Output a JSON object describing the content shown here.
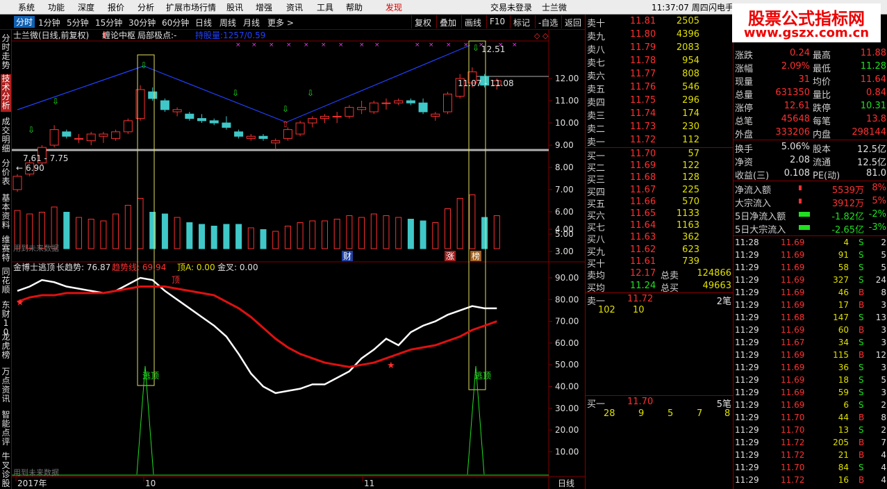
{
  "menu": [
    "系统",
    "功能",
    "深度",
    "报价",
    "分析",
    "扩展市场行情",
    "股讯",
    "增强",
    "资讯",
    "工具",
    "帮助",
    "发现"
  ],
  "menu_status": {
    "login": "交易未登录",
    "stock": "士兰微",
    "time": "11:37:07 周四",
    "flash": "闪电手"
  },
  "periods": [
    "分时",
    "1分钟",
    "5分钟",
    "15分钟",
    "30分钟",
    "60分钟",
    "日线",
    "周线",
    "月线",
    "更多 >"
  ],
  "toolbar_buttons": [
    "复权",
    "叠加",
    "画线",
    "F10",
    "标记",
    "-自选",
    "返回"
  ],
  "side_tabs": [
    "分时走势",
    "技术分析",
    "成交明细",
    "分价表",
    "基本资料",
    "维赛特",
    "同花顺",
    "东财10",
    "龙虎榜",
    "万点资讯",
    "智能点评",
    "牛叉诊股"
  ],
  "logo": {
    "line1": "股票公式指标网",
    "line2": "www.gszx.com.cn"
  },
  "main_chart": {
    "header": "士兰微(日线,前复权)",
    "indicator1": "缠论中枢",
    "indicator2": "局部极点:-",
    "indicator3": "持股量:1257/0.59",
    "price_ticks": [
      "12.00",
      "11.00",
      "10.00",
      "9.00",
      "8.00",
      "7.00",
      "6.00",
      "5.00",
      "4.00",
      "3.00"
    ],
    "label_high": "12.51",
    "label_range_top": "11.07 - 11.08",
    "label_range_bot": "7.61 - 7.75",
    "label_low": "6.90",
    "volume_note": "用到未来数据",
    "badges": [
      "财",
      "涨",
      "榜"
    ]
  },
  "chart_data": {
    "type": "candlestick",
    "title": "士兰微(日线,前复权)",
    "candles": [
      {
        "o": 7.0,
        "h": 7.7,
        "l": 6.9,
        "c": 7.6
      },
      {
        "o": 7.7,
        "h": 8.3,
        "l": 7.6,
        "c": 8.2
      },
      {
        "o": 8.2,
        "h": 9.0,
        "l": 8.1,
        "c": 8.9
      },
      {
        "o": 9.0,
        "h": 9.9,
        "l": 8.9,
        "c": 9.7
      },
      {
        "o": 9.6,
        "h": 9.7,
        "l": 9.3,
        "c": 9.4
      },
      {
        "o": 9.3,
        "h": 9.5,
        "l": 9.1,
        "c": 9.3
      },
      {
        "o": 9.2,
        "h": 9.6,
        "l": 9.0,
        "c": 9.5
      },
      {
        "o": 9.4,
        "h": 9.6,
        "l": 9.1,
        "c": 9.5
      },
      {
        "o": 9.3,
        "h": 9.7,
        "l": 9.2,
        "c": 9.6
      },
      {
        "o": 9.6,
        "h": 10.2,
        "l": 9.5,
        "c": 10.1
      },
      {
        "o": 10.2,
        "h": 11.7,
        "l": 10.1,
        "c": 11.5
      },
      {
        "o": 11.4,
        "h": 11.6,
        "l": 11.0,
        "c": 11.1
      },
      {
        "o": 11.0,
        "h": 11.1,
        "l": 10.5,
        "c": 10.6
      },
      {
        "o": 10.5,
        "h": 10.7,
        "l": 10.3,
        "c": 10.6
      },
      {
        "o": 10.4,
        "h": 10.5,
        "l": 10.1,
        "c": 10.2
      },
      {
        "o": 10.2,
        "h": 10.4,
        "l": 10.0,
        "c": 10.1
      },
      {
        "o": 10.1,
        "h": 10.2,
        "l": 9.9,
        "c": 10.0
      },
      {
        "o": 10.0,
        "h": 10.3,
        "l": 9.7,
        "c": 9.8
      },
      {
        "o": 9.6,
        "h": 9.7,
        "l": 9.3,
        "c": 9.4
      },
      {
        "o": 9.3,
        "h": 9.5,
        "l": 9.2,
        "c": 9.4
      },
      {
        "o": 9.4,
        "h": 9.5,
        "l": 9.2,
        "c": 9.3
      },
      {
        "o": 9.1,
        "h": 9.3,
        "l": 8.8,
        "c": 9.2
      },
      {
        "o": 9.3,
        "h": 9.8,
        "l": 9.2,
        "c": 9.7
      },
      {
        "o": 9.5,
        "h": 10.1,
        "l": 9.4,
        "c": 10.0
      },
      {
        "o": 10.0,
        "h": 10.3,
        "l": 9.8,
        "c": 10.2
      },
      {
        "o": 10.2,
        "h": 10.4,
        "l": 10.0,
        "c": 10.3
      },
      {
        "o": 10.3,
        "h": 10.5,
        "l": 10.0,
        "c": 10.3
      },
      {
        "o": 10.3,
        "h": 10.8,
        "l": 10.2,
        "c": 10.7
      },
      {
        "o": 10.6,
        "h": 11.0,
        "l": 10.4,
        "c": 10.7
      },
      {
        "o": 10.5,
        "h": 11.0,
        "l": 10.4,
        "c": 10.9
      },
      {
        "o": 10.9,
        "h": 11.1,
        "l": 10.6,
        "c": 10.9
      },
      {
        "o": 10.9,
        "h": 11.1,
        "l": 10.8,
        "c": 11.0
      },
      {
        "o": 11.0,
        "h": 11.1,
        "l": 10.8,
        "c": 10.9
      },
      {
        "o": 10.9,
        "h": 11.1,
        "l": 10.4,
        "c": 10.5
      },
      {
        "o": 10.3,
        "h": 10.5,
        "l": 10.1,
        "c": 10.4
      },
      {
        "o": 10.5,
        "h": 11.4,
        "l": 10.4,
        "c": 11.3
      },
      {
        "o": 11.2,
        "h": 12.2,
        "l": 11.1,
        "c": 12.0
      },
      {
        "o": 11.8,
        "h": 12.5,
        "l": 11.6,
        "c": 12.3
      },
      {
        "o": 12.1,
        "h": 12.2,
        "l": 11.6,
        "c": 11.7
      },
      {
        "o": 11.7,
        "h": 12.0,
        "l": 11.5,
        "c": 11.9
      }
    ],
    "volume": [
      2.2,
      2.0,
      2.1,
      2.4,
      2.1,
      1.8,
      1.7,
      1.6,
      2.0,
      2.5,
      2.9,
      2.1,
      2.0,
      1.8,
      1.5,
      1.4,
      1.3,
      1.4,
      1.4,
      1.2,
      1.1,
      1.0,
      1.3,
      1.5,
      1.6,
      1.6,
      1.7,
      1.9,
      1.8,
      2.0,
      1.9,
      1.8,
      1.7,
      1.6,
      1.5,
      2.3,
      2.9,
      3.1,
      1.8,
      1.9
    ],
    "osc_ticks": [
      "90.00",
      "80.00",
      "70.00",
      "60.00",
      "50.00",
      "40.00",
      "30.00",
      "20.00",
      "10.00"
    ],
    "white_line": [
      84,
      86,
      89,
      88,
      86,
      85,
      84,
      83,
      84,
      87,
      90,
      89,
      84,
      80,
      76,
      72,
      68,
      63,
      55,
      46,
      40,
      37,
      38,
      39,
      41,
      41,
      44,
      47,
      53,
      57,
      62,
      59,
      65,
      68,
      70,
      73,
      75,
      77,
      76,
      76
    ],
    "red_line": [
      79,
      81,
      82,
      82,
      83,
      83,
      83,
      83,
      84,
      85,
      86,
      86,
      86,
      85,
      84,
      83,
      82,
      79,
      76,
      72,
      67,
      62,
      58,
      55,
      53,
      51,
      50,
      49,
      50,
      51,
      53,
      55,
      57,
      58,
      59,
      61,
      63,
      66,
      68,
      70
    ],
    "x_labels": [
      "2017年",
      "10",
      "11"
    ]
  },
  "sub_chart": {
    "name": "金博士逃顶",
    "long_trend_label": "长趋势: 76.87",
    "trend_label": "趋势线: 69.94",
    "top_label": "顶A: 0.00",
    "gold_label": "金叉: 0.00",
    "top_mark": "顶",
    "escape1": "逃顶",
    "escape2": "逃顶",
    "future_note": "用到未来数据",
    "bottom_tab": "日线"
  },
  "quote": {
    "asks": [
      {
        "l": "卖十",
        "p": "11.81",
        "v": "2505"
      },
      {
        "l": "卖九",
        "p": "11.80",
        "v": "4396"
      },
      {
        "l": "卖八",
        "p": "11.79",
        "v": "2083"
      },
      {
        "l": "卖七",
        "p": "11.78",
        "v": "954"
      },
      {
        "l": "卖六",
        "p": "11.77",
        "v": "808"
      },
      {
        "l": "卖五",
        "p": "11.76",
        "v": "546"
      },
      {
        "l": "卖四",
        "p": "11.75",
        "v": "296"
      },
      {
        "l": "卖三",
        "p": "11.74",
        "v": "174"
      },
      {
        "l": "卖二",
        "p": "11.73",
        "v": "230"
      },
      {
        "l": "卖一",
        "p": "11.72",
        "v": "112"
      }
    ],
    "bids": [
      {
        "l": "买一",
        "p": "11.70",
        "v": "57"
      },
      {
        "l": "买二",
        "p": "11.69",
        "v": "122"
      },
      {
        "l": "买三",
        "p": "11.68",
        "v": "128"
      },
      {
        "l": "买四",
        "p": "11.67",
        "v": "225"
      },
      {
        "l": "买五",
        "p": "11.66",
        "v": "570"
      },
      {
        "l": "买六",
        "p": "11.65",
        "v": "1133"
      },
      {
        "l": "买七",
        "p": "11.64",
        "v": "1163"
      },
      {
        "l": "买八",
        "p": "11.63",
        "v": "362"
      },
      {
        "l": "买九",
        "p": "11.62",
        "v": "623"
      },
      {
        "l": "买十",
        "p": "11.61",
        "v": "739"
      }
    ],
    "ask_avg_label": "卖均",
    "ask_avg": "12.17",
    "total_sell_label": "总卖",
    "total_sell": "124866",
    "bid_avg_label": "买均",
    "bid_avg": "11.24",
    "total_buy_label": "总买",
    "total_buy": "49663",
    "sell1_label": "卖一",
    "sell1_price": "11.72",
    "sell1_count": "2笔",
    "sell1_orders": [
      "102",
      "10"
    ],
    "buy1_label": "买一",
    "buy1_price": "11.70",
    "buy1_count": "5笔",
    "buy1_orders": [
      "28",
      "9",
      "5",
      "7",
      "8"
    ]
  },
  "info": {
    "rows1": [
      {
        "a": "涨跌",
        "av": "0.24",
        "b": "最高",
        "bv": "11.88"
      },
      {
        "a": "涨幅",
        "av": "2.09%",
        "b": "最低",
        "bv": "11.28"
      },
      {
        "a": "现量",
        "av": "31",
        "b": "均价",
        "bv": "11.64"
      },
      {
        "a": "总量",
        "av": "631350",
        "b": "量比",
        "bv": "0.84"
      },
      {
        "a": "涨停",
        "av": "12.61",
        "b": "跌停",
        "bv": "10.31"
      },
      {
        "a": "总笔",
        "av": "45648",
        "b": "每笔",
        "bv": "13.8"
      },
      {
        "a": "外盘",
        "av": "333206",
        "b": "内盘",
        "bv": "298144"
      }
    ],
    "rows2": [
      {
        "a": "换手",
        "av": "5.06%",
        "b": "股本",
        "bv": "12.5亿"
      },
      {
        "a": "净资",
        "av": "2.08",
        "b": "流通",
        "bv": "12.5亿"
      },
      {
        "a": "收益(三)",
        "av": "0.108",
        "b": "PE(动)",
        "bv": "81.0"
      }
    ],
    "flows": [
      {
        "a": "净流入额",
        "v": "5539万",
        "p": "8%",
        "neg": false
      },
      {
        "a": "大宗流入",
        "v": "3912万",
        "p": "5%",
        "neg": false
      },
      {
        "a": "5日净流入额",
        "v": "-1.82亿",
        "p": "-2%",
        "neg": true
      },
      {
        "a": "5日大宗流入",
        "v": "-2.65亿",
        "p": "-3%",
        "neg": true
      }
    ],
    "ticks": [
      {
        "t": "11:28",
        "p": "11.69",
        "v": "4",
        "s": "S",
        "n": "2"
      },
      {
        "t": "11:29",
        "p": "11.69",
        "v": "91",
        "s": "S",
        "n": "5"
      },
      {
        "t": "11:29",
        "p": "11.69",
        "v": "58",
        "s": "S",
        "n": "5"
      },
      {
        "t": "11:29",
        "p": "11.69",
        "v": "327",
        "s": "S",
        "n": "24"
      },
      {
        "t": "11:29",
        "p": "11.69",
        "v": "46",
        "s": "B",
        "n": "8"
      },
      {
        "t": "11:29",
        "p": "11.69",
        "v": "17",
        "s": "B",
        "n": "3"
      },
      {
        "t": "11:29",
        "p": "11.68",
        "v": "147",
        "s": "S",
        "n": "13"
      },
      {
        "t": "11:29",
        "p": "11.69",
        "v": "60",
        "s": "B",
        "n": "3"
      },
      {
        "t": "11:29",
        "p": "11.67",
        "v": "34",
        "s": "S",
        "n": "3"
      },
      {
        "t": "11:29",
        "p": "11.69",
        "v": "115",
        "s": "B",
        "n": "12"
      },
      {
        "t": "11:29",
        "p": "11.69",
        "v": "36",
        "s": "S",
        "n": "3"
      },
      {
        "t": "11:29",
        "p": "11.69",
        "v": "18",
        "s": "S",
        "n": "5"
      },
      {
        "t": "11:29",
        "p": "11.69",
        "v": "59",
        "s": "S",
        "n": "3"
      },
      {
        "t": "11:29",
        "p": "11.69",
        "v": "6",
        "s": "S",
        "n": "2"
      },
      {
        "t": "11:29",
        "p": "11.70",
        "v": "44",
        "s": "B",
        "n": "8"
      },
      {
        "t": "11:29",
        "p": "11.70",
        "v": "13",
        "s": "S",
        "n": "2"
      },
      {
        "t": "11:29",
        "p": "11.72",
        "v": "205",
        "s": "B",
        "n": "7"
      },
      {
        "t": "11:29",
        "p": "11.72",
        "v": "21",
        "s": "B",
        "n": "4"
      },
      {
        "t": "11:29",
        "p": "11.70",
        "v": "84",
        "s": "S",
        "n": "4"
      },
      {
        "t": "11:29",
        "p": "11.72",
        "v": "16",
        "s": "B",
        "n": "4"
      }
    ]
  },
  "colors": {
    "up": "#ff3030",
    "down": "#40c8c8",
    "grid": "#800000",
    "yellow": "#e0e000"
  }
}
